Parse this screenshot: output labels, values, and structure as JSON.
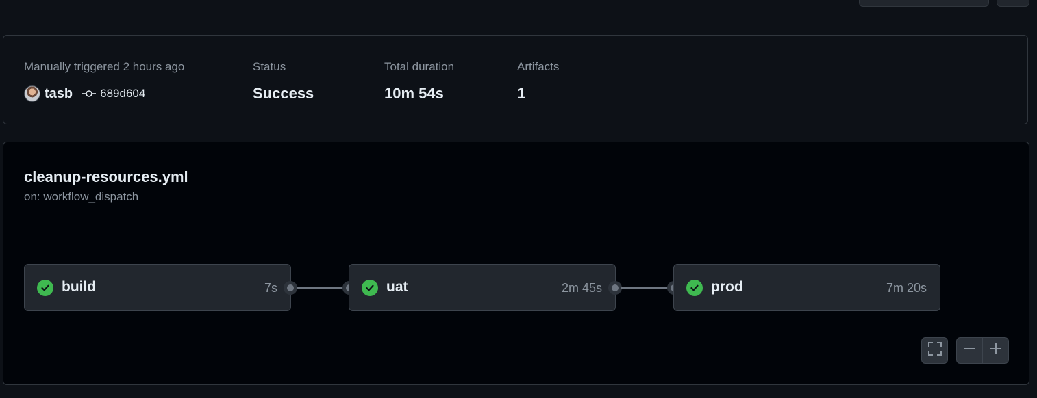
{
  "summary": {
    "trigger_label": "Manually triggered 2 hours ago",
    "actor": "tasb",
    "commit": "689d604",
    "status_label": "Status",
    "status_value": "Success",
    "duration_label": "Total duration",
    "duration_value": "10m 54s",
    "artifacts_label": "Artifacts",
    "artifacts_value": "1"
  },
  "workflow": {
    "file": "cleanup-resources.yml",
    "trigger": "on: workflow_dispatch"
  },
  "jobs": [
    {
      "name": "build",
      "duration": "7s",
      "status": "success"
    },
    {
      "name": "uat",
      "duration": "2m 45s",
      "status": "success"
    },
    {
      "name": "prod",
      "duration": "7m 20s",
      "status": "success"
    }
  ],
  "controls": {
    "fullscreen_icon": "fullscreen-icon",
    "zoom_out_icon": "minus-icon",
    "zoom_in_icon": "plus-icon"
  },
  "colors": {
    "success": "#3fb950",
    "background": "#0d1117",
    "canvas": "#010409"
  }
}
